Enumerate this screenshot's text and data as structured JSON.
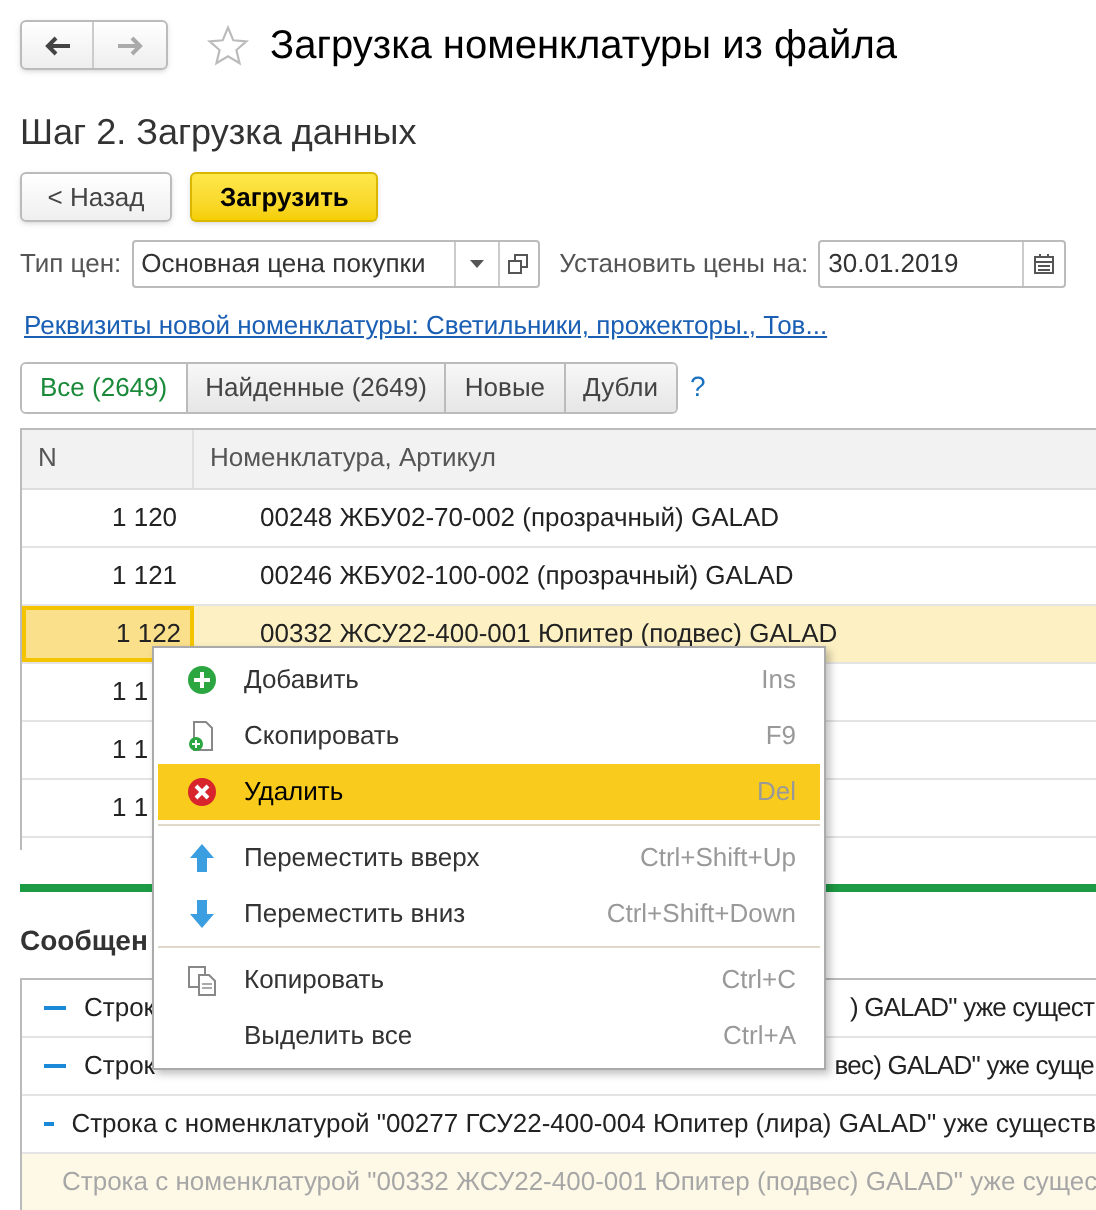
{
  "window": {
    "title": "Загрузка номенклатуры из файла",
    "favorite": false
  },
  "step_title": "Шаг 2. Загрузка данных",
  "buttons": [
    {
      "label": "< Назад",
      "kind": "plain"
    },
    {
      "label": "Загрузить",
      "kind": "primary"
    }
  ],
  "price_type": {
    "label": "Тип цен:",
    "value": "Основная цена покупки"
  },
  "price_date": {
    "label": "Установить цены на:",
    "value": "30.01.2019"
  },
  "attributes_link": "Реквизиты новой номенклатуры: Светильники, прожекторы., Тов...",
  "filter_tabs": [
    {
      "label": "Все (2649)",
      "selected": true
    },
    {
      "label": "Найденные (2649)",
      "selected": false
    },
    {
      "label": "Новые",
      "selected": false
    },
    {
      "label": "Дубли",
      "selected": false
    }
  ],
  "help": "?",
  "table": {
    "columns": [
      "N",
      "Номенклатура, Артикул"
    ],
    "rows": [
      {
        "n": "1 120",
        "item": "00248 ЖБУ02-70-002 (прозрачный) GALAD",
        "selected": false
      },
      {
        "n": "1 121",
        "item": "00246 ЖБУ02-100-002 (прозрачный) GALAD",
        "selected": false
      },
      {
        "n": "1 122",
        "item": "00332 ЖСУ22-400-001 Юпитер (подвес) GALAD",
        "selected": true
      },
      {
        "n": "1 1",
        "selected": false
      },
      {
        "n": "1 1",
        "selected": false
      },
      {
        "n": "1 1",
        "selected": false
      }
    ]
  },
  "messages": {
    "title": "Сообщен",
    "rows": [
      {
        "start": "Строк",
        "end": ") GALAD\" уже сущест",
        "selected": false
      },
      {
        "start": "Строк",
        "end": "вес) GALAD\" уже суще",
        "selected": false
      },
      {
        "start": "Строка с номенклатурой \"00277 ГСУ22-400-004 Юпитер (лира) GALAD\" уже существ",
        "selected": false
      },
      {
        "start": "Строка с номенклатурой \"00332 ЖСУ22-400-001 Юпитер (подвес) GALAD\" уже сущес",
        "selected": true
      }
    ]
  },
  "context_menu": [
    {
      "kind": "add",
      "label": "Добавить",
      "shortcut": "Ins",
      "selected": false
    },
    {
      "kind": "duplicate",
      "label": "Скопировать",
      "shortcut": "F9",
      "selected": false
    },
    {
      "kind": "delete",
      "label": "Удалить",
      "shortcut": "Del",
      "selected": true
    },
    {
      "kind": "separator"
    },
    {
      "kind": "move-up",
      "label": "Переместить вверх",
      "shortcut": "Ctrl+Shift+Up",
      "selected": false
    },
    {
      "kind": "move-down",
      "label": "Переместить вниз",
      "shortcut": "Ctrl+Shift+Down",
      "selected": false
    },
    {
      "kind": "separator"
    },
    {
      "kind": "copy",
      "label": "Копировать",
      "shortcut": "Ctrl+C",
      "selected": false
    },
    {
      "kind": "plain",
      "label": "Выделить все",
      "shortcut": "Ctrl+A",
      "selected": false
    }
  ]
}
